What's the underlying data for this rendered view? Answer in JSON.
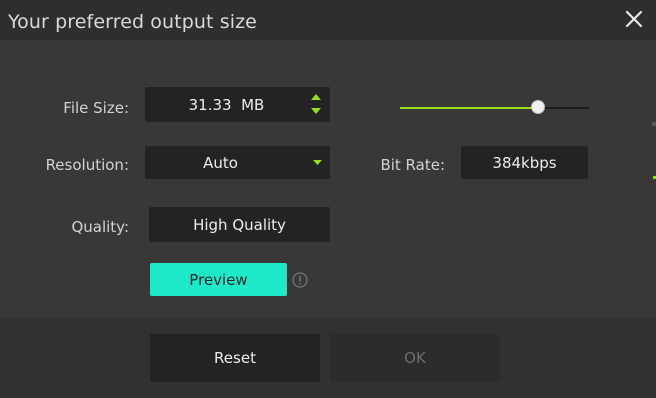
{
  "dialog": {
    "title": "Your preferred output size"
  },
  "file_size": {
    "label": "File Size:",
    "value": "31.33  MB"
  },
  "size_slider": {
    "level_fraction": 0.73,
    "fill_color": "#94e01c"
  },
  "resolution": {
    "label": "Resolution:",
    "value": "Auto"
  },
  "bit_rate": {
    "label": "Bit Rate:",
    "value": "384kbps"
  },
  "quality": {
    "label": "Quality:",
    "value": "High Quality"
  },
  "preview": {
    "label": "Preview",
    "color": "#1de9c8"
  },
  "footer": {
    "reset_label": "Reset",
    "ok_label": "OK"
  },
  "colors": {
    "accent_green": "#94e01c",
    "background": "#3a3837",
    "field_background": "#242323"
  },
  "icons": [
    "close-icon",
    "stepper-up-icon",
    "stepper-down-icon",
    "dropdown-arrow-icon",
    "info-icon"
  ]
}
